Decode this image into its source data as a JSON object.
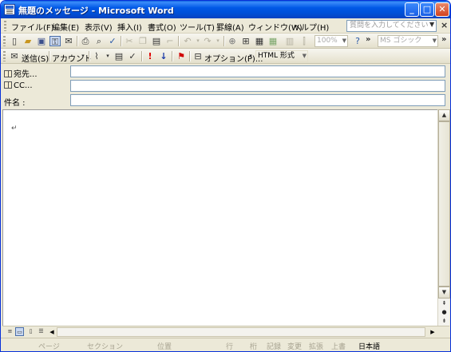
{
  "window": {
    "title": "無題のメッセージ - Microsoft Word",
    "minimize": "_",
    "maximize": "□",
    "close": "✕"
  },
  "menu": {
    "items": [
      "ファイル(F)",
      "編集(E)",
      "表示(V)",
      "挿入(I)",
      "書式(O)",
      "ツール(T)",
      "罫線(A)",
      "ウィンドウ(W)",
      "ヘルプ(H)"
    ],
    "help_placeholder": "質問を入力してください",
    "close": "×"
  },
  "toolbar_standard": {
    "zoom": "100%",
    "font": "MS ゴシック",
    "icons": [
      "new-icon",
      "open-icon",
      "save-icon",
      "permission-icon",
      "email-icon",
      "print-icon",
      "print-preview-icon",
      "spelling-icon",
      "cut-icon",
      "copy-icon",
      "paste-icon",
      "format-painter-icon",
      "undo-icon",
      "redo-icon",
      "hyperlink-icon",
      "tables-borders-icon",
      "insert-table-icon",
      "insert-excel-icon",
      "columns-icon",
      "drawing-icon",
      "help-icon"
    ]
  },
  "toolbar_email": {
    "send": "送信(S)",
    "account": "アカウント",
    "options": "オプション(P)...",
    "format": "HTML 形式",
    "icons": [
      "attach-icon",
      "address-book-icon",
      "check-names-icon",
      "high-importance-icon",
      "low-importance-icon",
      "flag-icon",
      "bcc-icon"
    ]
  },
  "mail_header": {
    "to_label": "宛先...",
    "to_value": "",
    "cc_label": "CC...",
    "cc_value": "",
    "subject_label": "件名 :",
    "subject_value": ""
  },
  "document": {
    "paragraph_mark": "↵"
  },
  "status_bar": {
    "page": "ページ",
    "section": "セクション",
    "position": "位置",
    "line": "行",
    "column": "桁",
    "record": "記録",
    "track": "変更",
    "extend": "拡張",
    "overwrite": "上書",
    "language": "日本語"
  }
}
